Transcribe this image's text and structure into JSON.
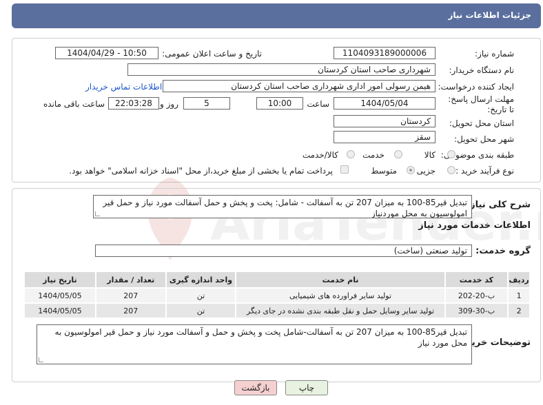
{
  "header": {
    "title": "جزئیات اطلاعات نیاز"
  },
  "form": {
    "need_number_label": "شماره نیاز:",
    "need_number": "1104093189000006",
    "announce_label": "تاریخ و ساعت اعلان عمومی:",
    "announce_value": "1404/04/29 - 10:50",
    "buyer_label": "نام دستگاه خریدار:",
    "buyer_value": "شهرداری صاحب استان کردستان",
    "creator_label": "ایجاد کننده درخواست:",
    "creator_value": "هیمن رسولی امور اداری شهرداری صاحب استان کردستان",
    "contact_link": "اطلاعات تماس خریدار",
    "deadline_label": "مهلت ارسال پاسخ: تا تاریخ:",
    "deadline_date": "1404/05/04",
    "time_label": "ساعت",
    "deadline_time": "10:00",
    "days_value": "5",
    "days_label": "روز و",
    "remaining_time": "22:03:28",
    "remaining_label": "ساعت باقی مانده",
    "province_label": "استان محل تحویل:",
    "province_value": "کردستان",
    "city_label": "شهر محل تحویل:",
    "city_value": "سقز",
    "category_label": "طبقه بندی موضوعی:",
    "category_options": [
      "کالا",
      "خدمت",
      "کالا/خدمت"
    ],
    "process_label": "نوع فرآیند خرید :",
    "process_options": [
      "جزیی",
      "متوسط"
    ],
    "treasury_note": "پرداخت تمام یا بخشی از مبلغ خرید،از محل \"اسناد خزانه اسلامی\" خواهد بود."
  },
  "summary": {
    "label": "شرح کلی نیاز:",
    "value": "تبدیل قیر85-100 به میزان 207 تن به آسفالت - شامل: پخت و پخش و حمل  آسفالت مورد نیاز و حمل قیر امولوسیون به محل موردنیاز"
  },
  "services": {
    "section_title": "اطلاعات خدمات مورد نیاز",
    "group_label": "گروه خدمت:",
    "group_value": "تولید صنعتی (ساخت)",
    "columns": [
      "ردیف",
      "کد خدمت",
      "نام خدمت",
      "واحد اندازه گیری",
      "تعداد / مقدار",
      "تاریخ نیاز"
    ],
    "rows": [
      [
        "1",
        "ب-20-202",
        "تولید سایر فراورده های شیمیایی",
        "تن",
        "207",
        "1404/05/05"
      ],
      [
        "2",
        "ب-30-309",
        "تولید سایر وسایل حمل و نقل طبقه بندی نشده در جای دیگر",
        "تن",
        "207",
        "1404/05/05"
      ]
    ]
  },
  "buyer_notes": {
    "label": "توضیحات خریدار:",
    "value": "تبدیل قیر85-100 به میزان 207 تن به آسفالت-شامل پخت و پخش و حمل و آسفالت مورد نیاز و حمل قیر امولوسیون به محل مورد نیاز"
  },
  "buttons": {
    "print": "چاپ",
    "back": "بازگشت"
  },
  "watermark": {
    "text": "AriaTender.net"
  },
  "colors": {
    "header": "#5a6f9e",
    "link": "#1a56c9",
    "back_button": "#f5d0d0",
    "print_button": "#e8f2e0"
  }
}
